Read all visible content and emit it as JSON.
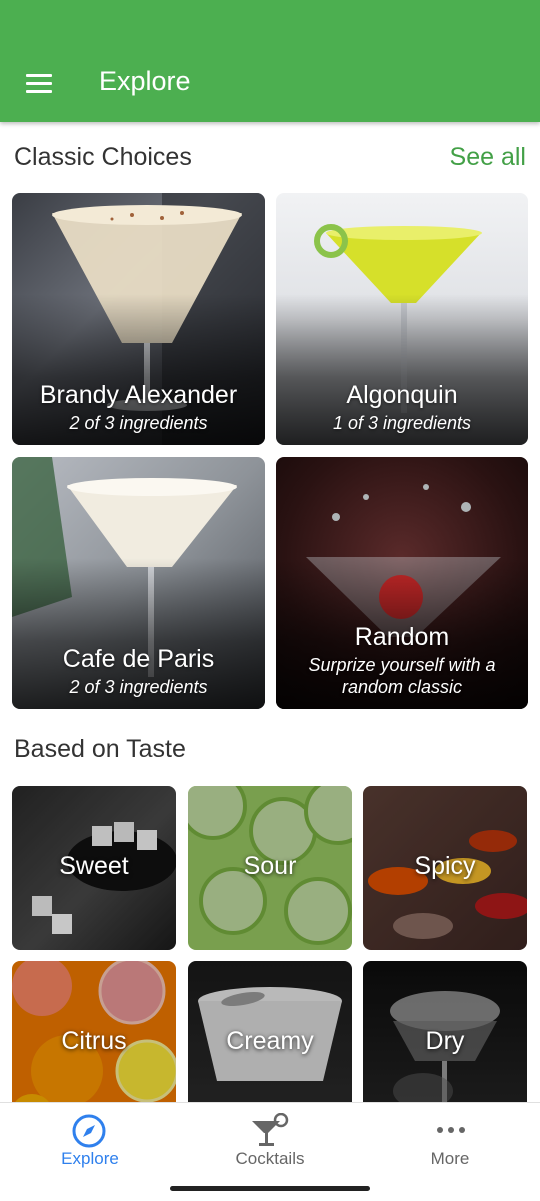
{
  "header": {
    "title": "Explore",
    "menu_icon": "menu-icon"
  },
  "classic": {
    "title": "Classic Choices",
    "see_all": "See all",
    "cards": [
      {
        "name": "Brandy Alexander",
        "subtitle": "2 of 3 ingredients"
      },
      {
        "name": "Algonquin",
        "subtitle": "1 of 3 ingredients"
      },
      {
        "name": "Cafe de Paris",
        "subtitle": "2 of 3 ingredients"
      },
      {
        "name": "Random",
        "subtitle_line1": "Surprize yourself with a",
        "subtitle_line2": "random classic"
      }
    ]
  },
  "taste": {
    "title": "Based on Taste",
    "tiles": [
      {
        "label": "Sweet"
      },
      {
        "label": "Sour"
      },
      {
        "label": "Spicy"
      },
      {
        "label": "Citrus"
      },
      {
        "label": "Creamy"
      },
      {
        "label": "Dry"
      }
    ]
  },
  "bottom_nav": {
    "items": [
      {
        "label": "Explore",
        "icon": "compass-icon",
        "active": true
      },
      {
        "label": "Cocktails",
        "icon": "cocktail-icon",
        "active": false
      },
      {
        "label": "More",
        "icon": "more-dots-icon",
        "active": false
      }
    ]
  },
  "colors": {
    "primary": "#4caf50",
    "see_all": "#43a047",
    "nav_active": "#2f80ed",
    "nav_inactive": "#666666"
  }
}
